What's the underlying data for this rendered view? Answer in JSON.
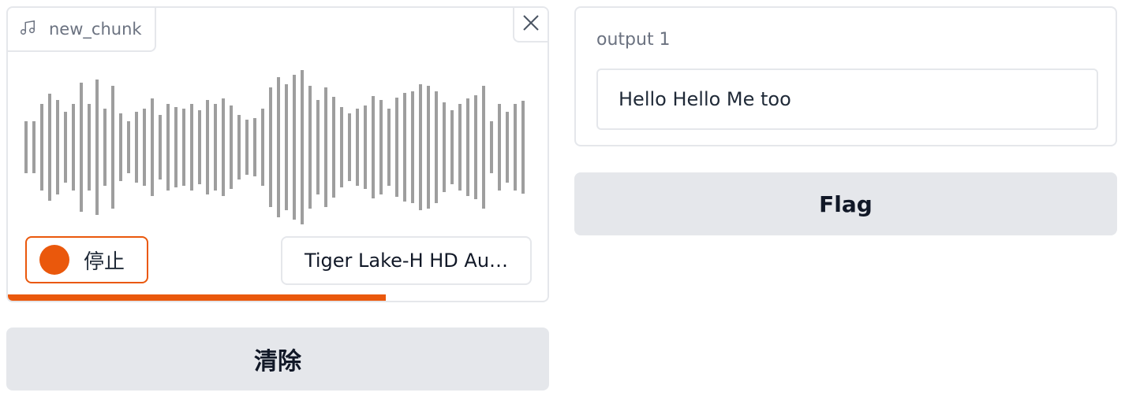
{
  "audio_input": {
    "label": "new_chunk",
    "label_icon": "music-note-icon",
    "close_icon": "close-icon",
    "stop_label": "停止",
    "device": "Tiger Lake-H HD Au…",
    "recording_progress": 0.7,
    "waveform_color": "#9e9e9e",
    "accent_color": "#ea580c",
    "waveform_levels": [
      0.33,
      0.33,
      0.55,
      0.68,
      0.6,
      0.45,
      0.55,
      0.82,
      0.55,
      0.86,
      0.49,
      0.78,
      0.43,
      0.33,
      0.45,
      0.49,
      0.62,
      0.41,
      0.55,
      0.51,
      0.49,
      0.55,
      0.47,
      0.6,
      0.55,
      0.62,
      0.53,
      0.41,
      0.35,
      0.37,
      0.49,
      0.76,
      0.89,
      0.8,
      0.92,
      0.98,
      0.78,
      0.6,
      0.76,
      0.64,
      0.51,
      0.43,
      0.49,
      0.53,
      0.65,
      0.6,
      0.49,
      0.63,
      0.69,
      0.71,
      0.8,
      0.78,
      0.71,
      0.57,
      0.47,
      0.55,
      0.62,
      0.66,
      0.78,
      0.33,
      0.55,
      0.45,
      0.55,
      0.59
    ]
  },
  "actions": {
    "clear_label": "清除",
    "flag_label": "Flag"
  },
  "output": {
    "label": "output 1",
    "value": "Hello Hello Me too"
  }
}
